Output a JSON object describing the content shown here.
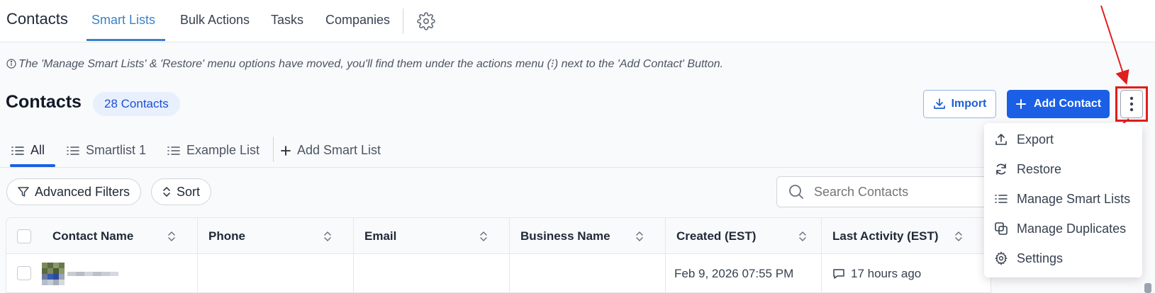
{
  "header": {
    "title": "Contacts",
    "tabs": [
      {
        "label": "Smart Lists",
        "active": true
      },
      {
        "label": "Bulk Actions",
        "active": false
      },
      {
        "label": "Tasks",
        "active": false
      },
      {
        "label": "Companies",
        "active": false
      }
    ],
    "settings_icon": "gear-icon"
  },
  "notice": {
    "icon": "info-icon",
    "text": "The 'Manage Smart Lists' & 'Restore' menu options have moved, you'll find them under the actions menu (⁝) next to the 'Add Contact' Button."
  },
  "page": {
    "heading": "Contacts",
    "count_badge": "28 Contacts"
  },
  "actions": {
    "import_label": "Import",
    "add_contact_label": "Add Contact",
    "more_icon": "vertical-dots-icon"
  },
  "list_tabs": [
    {
      "label": "All",
      "active": true
    },
    {
      "label": "Smartlist 1",
      "active": false
    },
    {
      "label": "Example List",
      "active": false
    },
    {
      "label": "Add Smart List",
      "active": false
    }
  ],
  "filters": {
    "advanced_label": "Advanced Filters",
    "sort_label": "Sort"
  },
  "search": {
    "placeholder": "Search Contacts"
  },
  "table": {
    "columns": [
      "Contact Name",
      "Phone",
      "Email",
      "Business Name",
      "Created (EST)",
      "Last Activity (EST)"
    ],
    "rows": [
      {
        "contact_name": "",
        "phone": "",
        "email": "",
        "business_name": "",
        "created": "Feb 9, 2026 07:55 PM",
        "last_activity": "17 hours ago"
      }
    ]
  },
  "menu": {
    "items": [
      {
        "label": "Export",
        "icon": "upload-icon"
      },
      {
        "label": "Restore",
        "icon": "refresh-icon"
      },
      {
        "label": "Manage Smart Lists",
        "icon": "list-icon"
      },
      {
        "label": "Manage Duplicates",
        "icon": "duplicate-icon"
      },
      {
        "label": "Settings",
        "icon": "gear-icon"
      }
    ]
  },
  "colors": {
    "primary": "#1a5fe6",
    "tab_active": "#3b82c4",
    "annotation_red": "#e11d1d"
  }
}
